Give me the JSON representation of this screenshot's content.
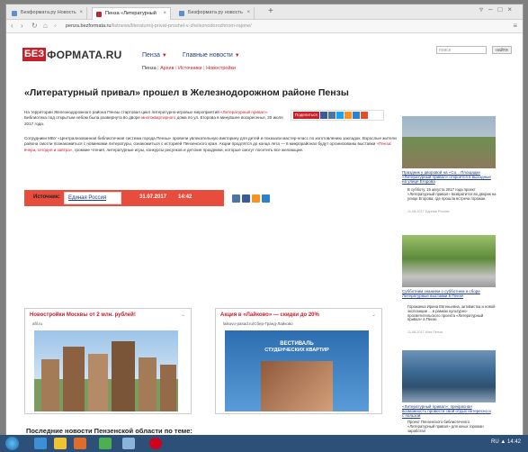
{
  "browser": {
    "tabs": [
      {
        "label": "Безформата.ру Новость"
      },
      {
        "label": "Пенза «Литературный"
      },
      {
        "label": "Безформата ру новость"
      }
    ],
    "url_host": "penza.bezformata.ru",
    "url_path": "/listnews/literaturnij-privat-proshel-v-zheleznodorozhnom-rajone/"
  },
  "site": {
    "logo_bez": "БЕЗ",
    "logo_rest": "ФОРМАТА.RU",
    "region": "Пенза",
    "main_news": "Главные новости",
    "subnav": [
      "Пенза",
      "Архив",
      "Источники",
      "Новостройки"
    ],
    "search_placeholder": "поиск",
    "search_button": "найти"
  },
  "article": {
    "title": "«Литературный привал» прошел в Железнодорожном районе Пензы",
    "p1_a": "На территории Железнодорожного района Пензы стартовал цикл литературно-игровых мероприятий",
    "p1_link": "«Литературный привал»",
    "p1_b": ". Библиотека под открытым небом была развернута во дворе",
    "p1_link2": "многоквартирного",
    "p1_c": "дома по ул. Егорова в минувшее воскресенье, 30 июля 2017 года.",
    "p2": "Сотрудники МБУ «Централизованная библиотечная система города Пензы» провели увлекательную викторину для детей и показали мастер-класс по изготовлению закладок. Взрослые жители района смогли познакомиться с новинками литературы, ознакомиться с историей Пензенского края.",
    "p2_b": "Акции продлятся до конца лета — в микрорайонах будут организованы выставки",
    "p2_link": "«Пенза: вчера, сегодня и завтра»",
    "p2_c": ", громкие чтения, литературные игры, конкурсы рисунков и детские праздники, которые смогут посетить все желающие.",
    "share_label": "Поделиться",
    "source_label": "Источник:",
    "source_name": "Единая Россия",
    "date": "31.07.2017",
    "time": "14:42"
  },
  "ads": [
    {
      "title": "Новостройки Москвы от 2 млн. рублей!",
      "domain": "afil.ru"
    },
    {
      "title": "Акция в «Лайково» — скидки до 20%",
      "domain": "laikovo-pasad.ru/Сбер-Гранд-Лайково",
      "banner_line1": "ВЕСТИВАЛЬ",
      "banner_line2": "СТУДЕНЧЕСКИХ КВАРТИР"
    }
  ],
  "bottom_heading": "Последние новости Пензенской области по теме:",
  "right_column": [
    {
      "caption": "Праздник у дворовой на «Со... Площадке «Литературный привал» откроется в выходные на улице Егорова",
      "text": "В субботу, 15 августа 2017 года проект «Литературный привал» возвратится во дворик на улице Егорова, где прошла встреча горожан.",
      "meta": "11.08.2017 Единая Россия"
    },
    {
      "caption": "Субботним знанием о субботнем и сборе Литературные выставки в Пензе",
      "text": "Горожанка Ирина Евгеньевна, активистка и новой экспозиции ... в рамках культурно-просветительского проекта «Литературный привал» в Пензе",
      "meta": "11.08.2017 Моя Пенза"
    },
    {
      "caption": "«Литературный привал»: прекрасная возможность провести свой отдых интересно и с пользой",
      "text": "Проект Пензенского библиотечного «Литературный привал» для юных горожан заработал",
      "meta": ""
    }
  ],
  "taskbar": {
    "tray_text": "RU  ▲  14:42"
  },
  "colors": {
    "brand_red": "#c8202a",
    "link_blue": "#1e3d8f",
    "source_bar": "#e74c3c",
    "taskbar": "#2c5078"
  }
}
